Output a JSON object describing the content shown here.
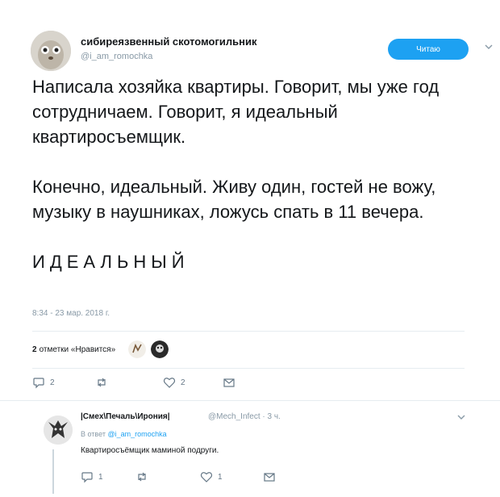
{
  "tweet": {
    "display_name": "сибиреязвенный скотомогильник",
    "handle": "@i_am_romochka",
    "follow_label": "Читаю",
    "paragraphs": [
      "Написала хозяйка квартиры. Говорит, мы уже год сотрудничаем. Говорит, я идеальный квартиросъемщик.",
      "Конечно, идеальный. Живу один, гостей не вожу, музыку в наушниках, ложусь спать в 11 вечера.",
      "ИДЕАЛЬНЫЙ"
    ],
    "timestamp": "8:34 - 23 мар. 2018 г.",
    "likes_count": "2",
    "likes_label": "отметки «Нравится»",
    "actions": {
      "reply_count": "2",
      "retweet_count": "",
      "like_count": "2"
    }
  },
  "reply": {
    "display_name": "|Смех\\Печаль\\Ирония|",
    "handle_time": "@Mech_Infect · 3 ч.",
    "reply_prefix": "В ответ",
    "reply_handle": "@i_am_romochka",
    "text": "Квартиросъёмщик маминой подруги.",
    "actions": {
      "reply_count": "1",
      "retweet_count": "",
      "like_count": "1"
    }
  },
  "colors": {
    "accent": "#1da1f2",
    "muted": "#8899a6",
    "text": "#14171a"
  },
  "icons": [
    "reply-icon",
    "retweet-icon",
    "heart-icon",
    "message-icon",
    "chevron-down-icon"
  ]
}
